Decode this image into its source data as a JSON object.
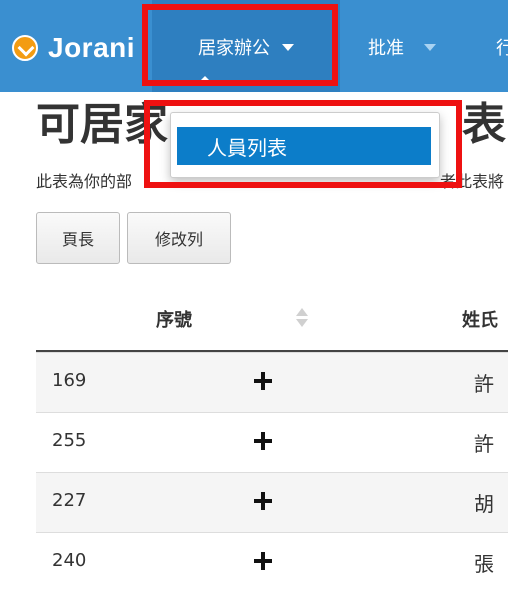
{
  "navbar": {
    "brand": "Jorani",
    "items": [
      {
        "label": "居家辦公"
      },
      {
        "label": "批准"
      },
      {
        "label": "行"
      }
    ],
    "dropdown": {
      "items": [
        {
          "label": "人員列表"
        }
      ]
    }
  },
  "page": {
    "title_start": "可居家",
    "title_end": "表",
    "description_start": "此表為你的部",
    "description_end": "者此表將"
  },
  "toolbar": {
    "page_length_button": "頁長",
    "edit_columns_button": "修改列"
  },
  "table": {
    "headers": {
      "id": "序號",
      "lastname": "姓氏"
    },
    "rows": [
      {
        "id": "169",
        "name": "許"
      },
      {
        "id": "255",
        "name": "許"
      },
      {
        "id": "227",
        "name": "胡"
      },
      {
        "id": "240",
        "name": "張"
      }
    ]
  },
  "colors": {
    "navbar": "#3a8fd0",
    "highlight": "#ee1111",
    "dropdown_active": "#0c7dc9"
  }
}
